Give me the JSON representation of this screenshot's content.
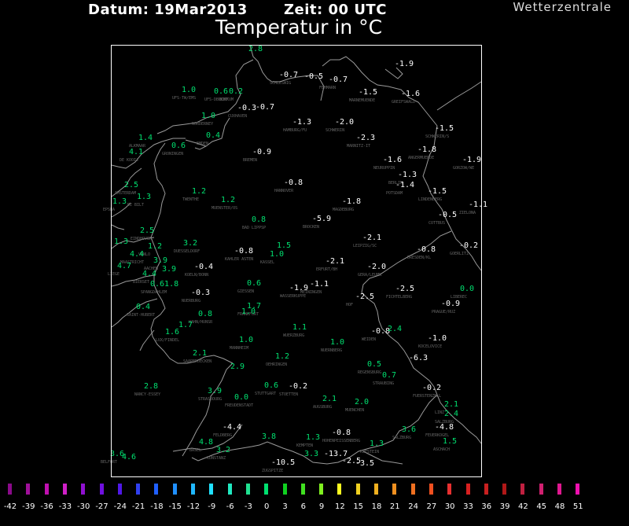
{
  "header": {
    "date_label": "Datum: 19Mar2013",
    "time_label": "Zeit: 00 UTC",
    "title": "Temperatur in °C",
    "brand": "Wetterzentrale"
  },
  "colors": {
    "positive": "#00e070",
    "negative": "#ffffff",
    "station_name": "#666666",
    "borders": "#9a9a9a"
  },
  "stations": [
    {
      "v": "2.8",
      "n": ""
    },
    {
      "v": "-0.7",
      "n": "SCHLESWIG"
    },
    {
      "v": "-0.5",
      "n": ""
    },
    {
      "v": "-0.7",
      "n": "FEHMARN"
    },
    {
      "v": "-1.9",
      "n": ""
    },
    {
      "v": "-1.5",
      "n": "MARNEMUENDE"
    },
    {
      "v": "-1.6",
      "n": "GREIFSWALD"
    },
    {
      "v": "1.0",
      "n": "UFS-TW/EMS"
    },
    {
      "v": "0.6",
      "n": "UFS-DBUCHT"
    },
    {
      "v": "0.2",
      "n": "BORKUM"
    },
    {
      "v": "-0.3",
      "n": "CUXHAVEN"
    },
    {
      "v": "-0.7",
      "n": ""
    },
    {
      "v": "1.0",
      "n": "NORDERNEY"
    },
    {
      "v": "-1.3",
      "n": "HAMBURG/FU"
    },
    {
      "v": "-2.0",
      "n": "SCHWERIN"
    },
    {
      "v": "-1.5",
      "n": "SCHWERIN/S"
    },
    {
      "v": "1.4",
      "n": "ALKMAAR"
    },
    {
      "v": "0.4",
      "n": "EMDEN"
    },
    {
      "v": "-2.3",
      "n": "MARNITZ-IT"
    },
    {
      "v": "0.6",
      "n": "GRONINGEN"
    },
    {
      "v": "-0.9",
      "n": "BREMEN"
    },
    {
      "v": "-1.8",
      "n": "ANGERMUENDE"
    },
    {
      "v": "-1.9",
      "n": "GORZOW/WE"
    },
    {
      "v": "4.1",
      "n": "DE KOOIJ"
    },
    {
      "v": "-1.6",
      "n": "NEURUPPIN"
    },
    {
      "v": "-1.3",
      "n": "BERLIN"
    },
    {
      "v": "-1.4",
      "n": "POTSDAM"
    },
    {
      "v": "2.5",
      "n": "AMSTERDAM"
    },
    {
      "v": "1.3",
      "n": "DE BILT"
    },
    {
      "v": "1.2",
      "n": "TWENTHE"
    },
    {
      "v": "1.2",
      "n": "MUENSTER/OS"
    },
    {
      "v": "-0.8",
      "n": "HANNOVER"
    },
    {
      "v": "-1.8",
      "n": "MAGDEBURG"
    },
    {
      "v": "-1.5",
      "n": "LINDENBERG"
    },
    {
      "v": "1.3",
      "n": "EPSWA"
    },
    {
      "v": "-0.5",
      "n": "COTTBUS"
    },
    {
      "v": "-1.1",
      "n": "ZIELONA"
    },
    {
      "v": "0.8",
      "n": "BAD LIPPSP"
    },
    {
      "v": "-5.9",
      "n": "BROCKEN"
    },
    {
      "v": "2.5",
      "n": "EINDHOVEN"
    },
    {
      "v": "1.3",
      "n": ""
    },
    {
      "v": "1.2",
      "n": "VENLO"
    },
    {
      "v": "3.2",
      "n": "DUESSELDORF"
    },
    {
      "v": "-2.1",
      "n": "LEIPZIG/SC"
    },
    {
      "v": "4.4",
      "n": "MAASTRICHT"
    },
    {
      "v": "-0.8",
      "n": "KAHLER ASTEN"
    },
    {
      "v": "1.5",
      "n": ""
    },
    {
      "v": "1.0",
      "n": "KASSEL"
    },
    {
      "v": "-0.8",
      "n": "DRESDEN/KL"
    },
    {
      "v": "-0.2",
      "n": "GOERLITZ"
    },
    {
      "v": "3.9",
      "n": "AACHEN"
    },
    {
      "v": "-2.1",
      "n": "ERFURT/BH"
    },
    {
      "v": "-2.0",
      "n": "GERA/LEUMN"
    },
    {
      "v": "4.7",
      "n": "LIEGE"
    },
    {
      "v": "3.9",
      "n": ""
    },
    {
      "v": "-0.4",
      "n": "KOELN/BONN"
    },
    {
      "v": "0.0",
      "n": "LIBEREC"
    },
    {
      "v": "4.4",
      "n": "BIERSET"
    },
    {
      "v": "0.6",
      "n": "GIESSEN"
    },
    {
      "v": "-1.9",
      "n": "WASSERKUPPE"
    },
    {
      "v": "-1.1",
      "n": "MEININGEN"
    },
    {
      "v": "0.61.8",
      "n": "SPANGDAHLEM"
    },
    {
      "v": "-0.3",
      "n": "NUERBURG"
    },
    {
      "v": "-2.5",
      "n": "HOF"
    },
    {
      "v": "-2.5",
      "n": "FICHTELBERG"
    },
    {
      "v": "0.4",
      "n": "SAINT-HUBERT"
    },
    {
      "v": "1.7",
      "n": "FRANKFURT"
    },
    {
      "v": "-0.9",
      "n": "PRAGUE/RUZ"
    },
    {
      "v": "0.8",
      "n": "HAHN/HUNSR"
    },
    {
      "v": "1.0",
      "n": ""
    },
    {
      "v": "1.7",
      "n": ""
    },
    {
      "v": "1.1",
      "n": "WUERZBURG"
    },
    {
      "v": "1.6",
      "n": "LUX/FINDEL"
    },
    {
      "v": "-0.8",
      "n": "WEIDEN"
    },
    {
      "v": "2.4",
      "n": ""
    },
    {
      "v": "-1.0",
      "n": "KOCELOVICE"
    },
    {
      "v": "1.0",
      "n": "MANNHEIM"
    },
    {
      "v": "1.0",
      "n": "NUERNBERG"
    },
    {
      "v": "2.1",
      "n": "SAARBRUECKEN"
    },
    {
      "v": "1.2",
      "n": "OEHRINGEN"
    },
    {
      "v": "-6.3",
      "n": ""
    },
    {
      "v": "0.5",
      "n": "REGENSBURG"
    },
    {
      "v": "2.9",
      "n": ""
    },
    {
      "v": "0.7",
      "n": "STRAUBING"
    },
    {
      "v": "2.8",
      "n": "NANCY-ESSEY"
    },
    {
      "v": "0.6",
      "n": "STUTTGART"
    },
    {
      "v": "-0.2",
      "n": "STOETTEN"
    },
    {
      "v": "-0.2",
      "n": "FUERSTENZELL"
    },
    {
      "v": "3.9",
      "n": "STRASBOURG"
    },
    {
      "v": "0.0",
      "n": "FREUDENSTADT"
    },
    {
      "v": "2.1",
      "n": "AUGSBURG"
    },
    {
      "v": "2.0",
      "n": "MUENCHEN"
    },
    {
      "v": "2.1",
      "n": "LINZ"
    },
    {
      "v": "2.4",
      "n": "SALZBURG"
    },
    {
      "v": "-4.4",
      "n": "FELDBERG"
    },
    {
      "v": "-0.8",
      "n": "HOHENPEISSENBERG"
    },
    {
      "v": "3.6",
      "n": "SALZBURG"
    },
    {
      "v": "-4.8",
      "n": "FEUERKOGEL"
    },
    {
      "v": "4.8",
      "n": "BASEL"
    },
    {
      "v": "3.2",
      "n": "KONSTANZ"
    },
    {
      "v": "1.3",
      "n": "KEMPTEN"
    },
    {
      "v": "1.3",
      "n": "KUFSTEIN"
    },
    {
      "v": "1.5",
      "n": "ASCHACH"
    },
    {
      "v": "3.8",
      "n": ""
    },
    {
      "v": "-10.5",
      "n": "ZUGSPITZE"
    },
    {
      "v": "-13.7",
      "n": ""
    },
    {
      "v": "-2.5",
      "n": ""
    },
    {
      "v": "3.6",
      "n": "BELFORT"
    },
    {
      "v": "-3.5",
      "n": ""
    },
    {
      "v": "3.3",
      "n": ""
    },
    {
      "v": "4.6",
      "n": ""
    }
  ],
  "legend": {
    "ticks": [
      "-42",
      "-39",
      "-36",
      "-33",
      "-30",
      "-27",
      "-24",
      "-21",
      "-18",
      "-15",
      "-12",
      "-9",
      "-6",
      "-3",
      "0",
      "3",
      "6",
      "9",
      "12",
      "15",
      "18",
      "21",
      "24",
      "27",
      "30",
      "33",
      "36",
      "39",
      "42",
      "45",
      "48",
      "51"
    ],
    "colors": [
      "#8a0a8a",
      "#a0109a",
      "#c010b0",
      "#d020c8",
      "#9010d0",
      "#7010e0",
      "#5018e8",
      "#3040f0",
      "#2060ff",
      "#2090ff",
      "#20b8ff",
      "#20e0ff",
      "#20e8c0",
      "#20e090",
      "#00e070",
      "#10d020",
      "#40e020",
      "#80f020",
      "#ffff20",
      "#f0d020",
      "#f0b020",
      "#f09020",
      "#f07020",
      "#f05020",
      "#e83030",
      "#d82020",
      "#c82020",
      "#b01818",
      "#c02040",
      "#d02070",
      "#e01890",
      "#f010b0"
    ]
  }
}
